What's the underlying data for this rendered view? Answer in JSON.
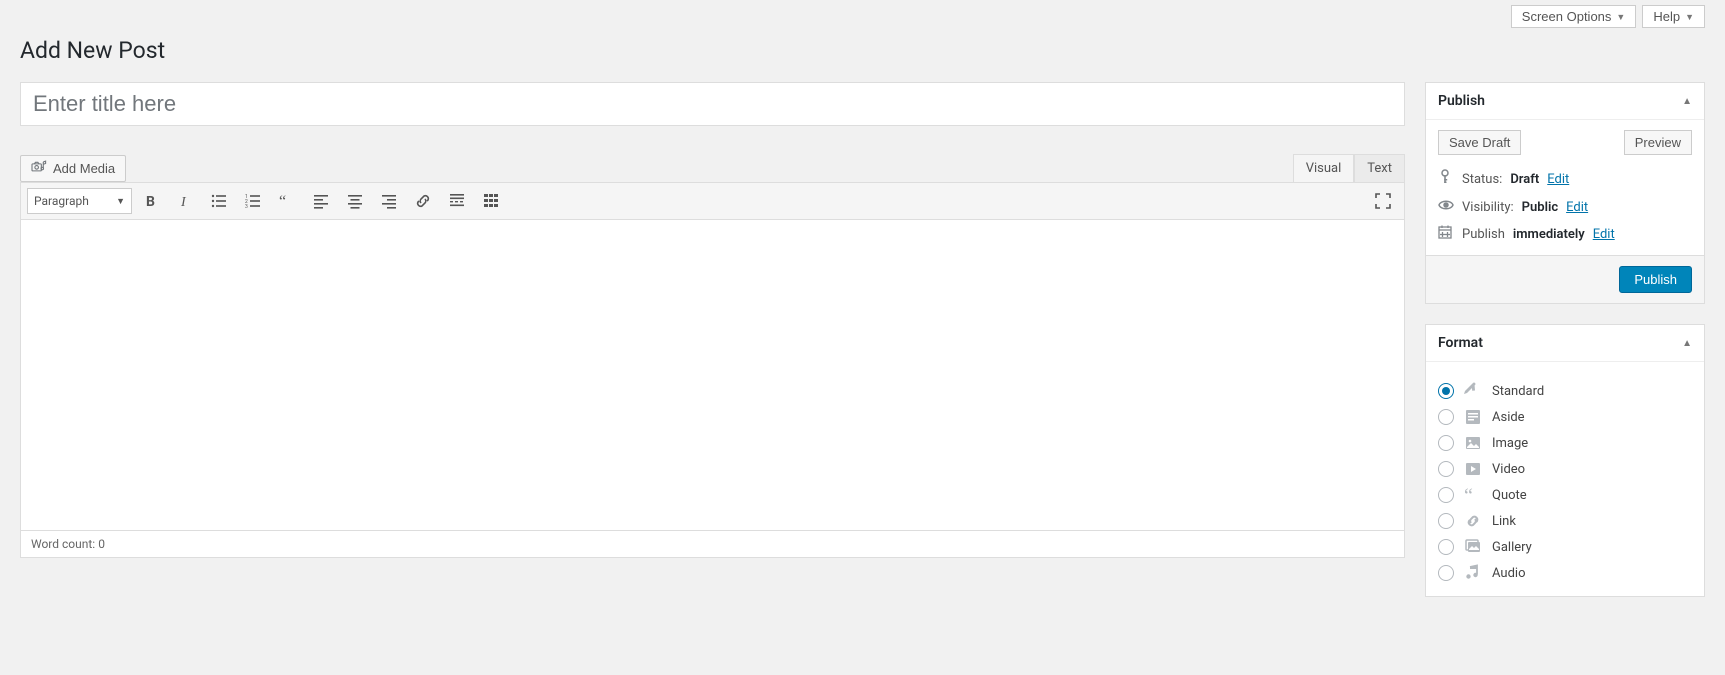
{
  "header": {
    "screen_options": "Screen Options",
    "help": "Help"
  },
  "page": {
    "title": "Add New Post"
  },
  "title_input": {
    "placeholder": "Enter title here",
    "value": ""
  },
  "media": {
    "add_media": "Add Media"
  },
  "editor": {
    "tabs": {
      "visual": "Visual",
      "text": "Text"
    },
    "format_select": "Paragraph",
    "word_count_label": "Word count:",
    "word_count": "0"
  },
  "publish": {
    "title": "Publish",
    "save_draft": "Save Draft",
    "preview": "Preview",
    "status_label": "Status:",
    "status_value": "Draft",
    "visibility_label": "Visibility:",
    "visibility_value": "Public",
    "publish_label": "Publish",
    "publish_value": "immediately",
    "edit": "Edit",
    "publish_button": "Publish"
  },
  "format": {
    "title": "Format",
    "options": [
      {
        "label": "Standard",
        "checked": true
      },
      {
        "label": "Aside",
        "checked": false
      },
      {
        "label": "Image",
        "checked": false
      },
      {
        "label": "Video",
        "checked": false
      },
      {
        "label": "Quote",
        "checked": false
      },
      {
        "label": "Link",
        "checked": false
      },
      {
        "label": "Gallery",
        "checked": false
      },
      {
        "label": "Audio",
        "checked": false
      }
    ]
  }
}
